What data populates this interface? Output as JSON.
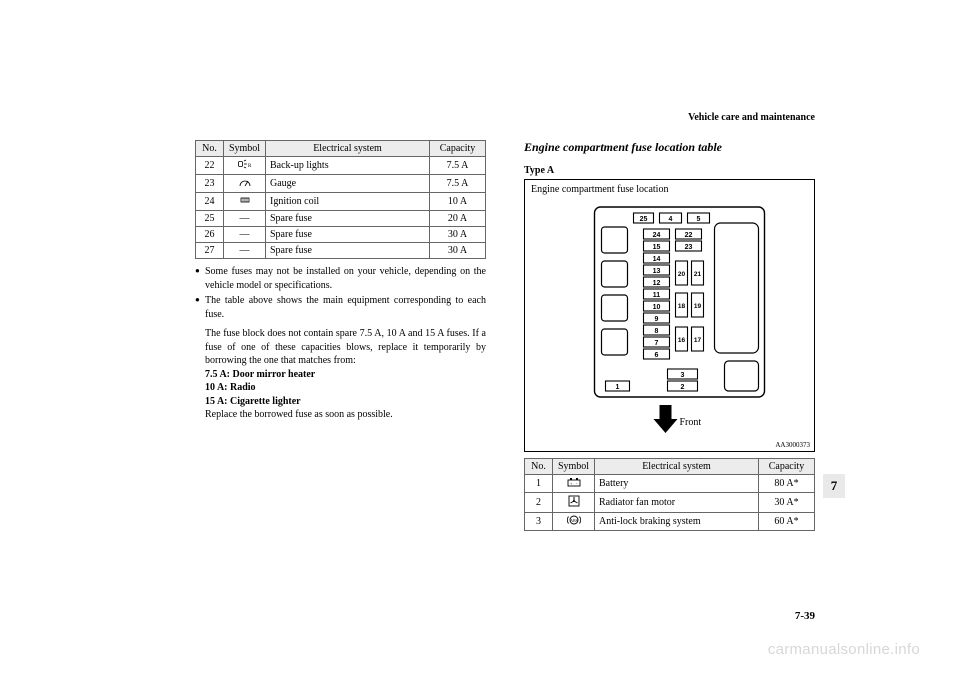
{
  "header": {
    "section": "Vehicle care and maintenance"
  },
  "left_table": {
    "headers": {
      "no": "No.",
      "symbol": "Symbol",
      "system": "Electrical system",
      "capacity": "Capacity"
    },
    "rows": [
      {
        "no": "22",
        "symbol": "backup-icon",
        "system": "Back-up lights",
        "capacity": "7.5 A"
      },
      {
        "no": "23",
        "symbol": "gauge-icon",
        "system": "Gauge",
        "capacity": "7.5 A"
      },
      {
        "no": "24",
        "symbol": "ignition-icon",
        "system": "Ignition coil",
        "capacity": "10 A"
      },
      {
        "no": "25",
        "symbol": "—",
        "system": "Spare fuse",
        "capacity": "20 A"
      },
      {
        "no": "26",
        "symbol": "—",
        "system": "Spare fuse",
        "capacity": "30 A"
      },
      {
        "no": "27",
        "symbol": "—",
        "system": "Spare fuse",
        "capacity": "30 A"
      }
    ]
  },
  "notes": {
    "bullet1": "Some fuses may not be installed on your vehicle, depending on the vehicle model or specifications.",
    "bullet2": "The table above shows the main equipment corresponding to each fuse.",
    "line3": "The fuse block does not contain spare 7.5 A, 10 A and 15 A fuses. If a fuse of one of these capacities blows, replace it temporarily by borrowing the one that matches from:",
    "l4": "7.5 A: Door mirror heater",
    "l5": "10 A: Radio",
    "l6": "15 A: Cigarette lighter",
    "l7": "Replace the borrowed fuse as soon as possible."
  },
  "right": {
    "title": "Engine compartment fuse location table",
    "type": "Type A",
    "figure_title": "Engine compartment fuse location",
    "front": "Front",
    "figure_id": "AA3000373"
  },
  "right_table": {
    "headers": {
      "no": "No.",
      "symbol": "Symbol",
      "system": "Electrical system",
      "capacity": "Capacity"
    },
    "rows": [
      {
        "no": "1",
        "symbol": "battery-icon",
        "system": "Battery",
        "capacity": "80 A*"
      },
      {
        "no": "2",
        "symbol": "fan-icon",
        "system": "Radiator fan motor",
        "capacity": "30 A*"
      },
      {
        "no": "3",
        "symbol": "abs-icon",
        "system": "Anti-lock braking system",
        "capacity": "60 A*"
      }
    ]
  },
  "fuse_diagram": {
    "labels": [
      "1",
      "2",
      "3",
      "4",
      "5",
      "6",
      "7",
      "8",
      "9",
      "10",
      "11",
      "12",
      "13",
      "14",
      "15",
      "16",
      "17",
      "18",
      "19",
      "20",
      "21",
      "22",
      "23",
      "24",
      "25"
    ]
  },
  "page": {
    "tab": "7",
    "num": "7-39"
  },
  "watermark": "carmanualsonline.info"
}
